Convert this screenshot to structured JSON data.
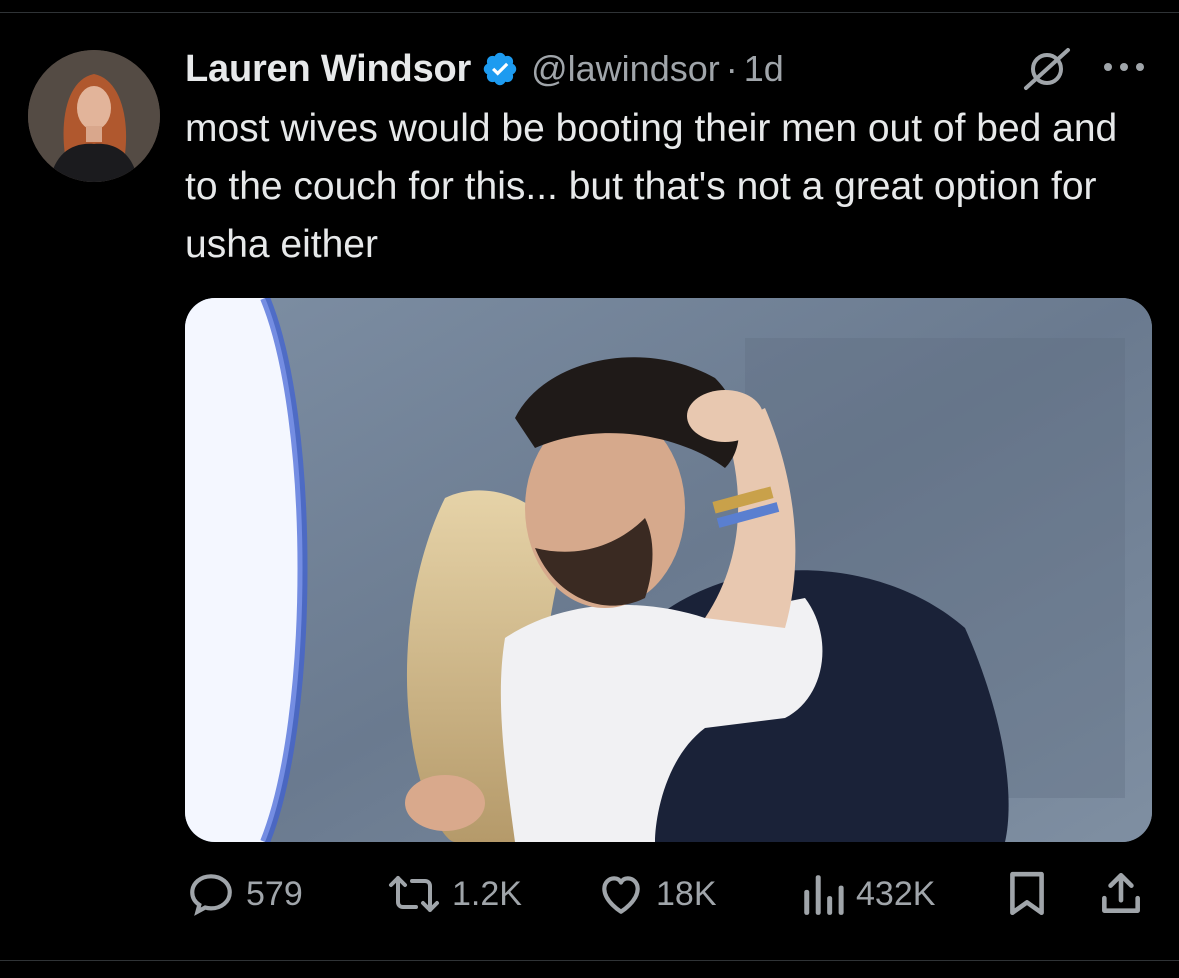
{
  "tweet": {
    "author": {
      "display_name": "Lauren Windsor",
      "handle": "@lawindsor",
      "verified": true,
      "avatar_icon": "profile-photo"
    },
    "separator": "·",
    "timestamp": "1d",
    "text": "most wives would be booting their men out of bed and to the couch for this... but that's not a great option for usha either",
    "media": {
      "type": "photo",
      "alt_icon": "photo-couple-hugging"
    },
    "header_icons": {
      "grok": "grok-icon",
      "more": "more-options-icon"
    },
    "actions": {
      "reply": {
        "icon": "reply-icon",
        "count": "579"
      },
      "retweet": {
        "icon": "retweet-icon",
        "count": "1.2K"
      },
      "like": {
        "icon": "like-icon",
        "count": "18K"
      },
      "views": {
        "icon": "views-icon",
        "count": "432K"
      },
      "bookmark": {
        "icon": "bookmark-icon"
      },
      "share": {
        "icon": "share-icon"
      }
    }
  },
  "colors": {
    "background": "#000000",
    "text_primary": "#e7e9ea",
    "text_secondary": "#a0a5aa",
    "verified_blue": "#1d9bf0",
    "divider": "#2f3336"
  }
}
